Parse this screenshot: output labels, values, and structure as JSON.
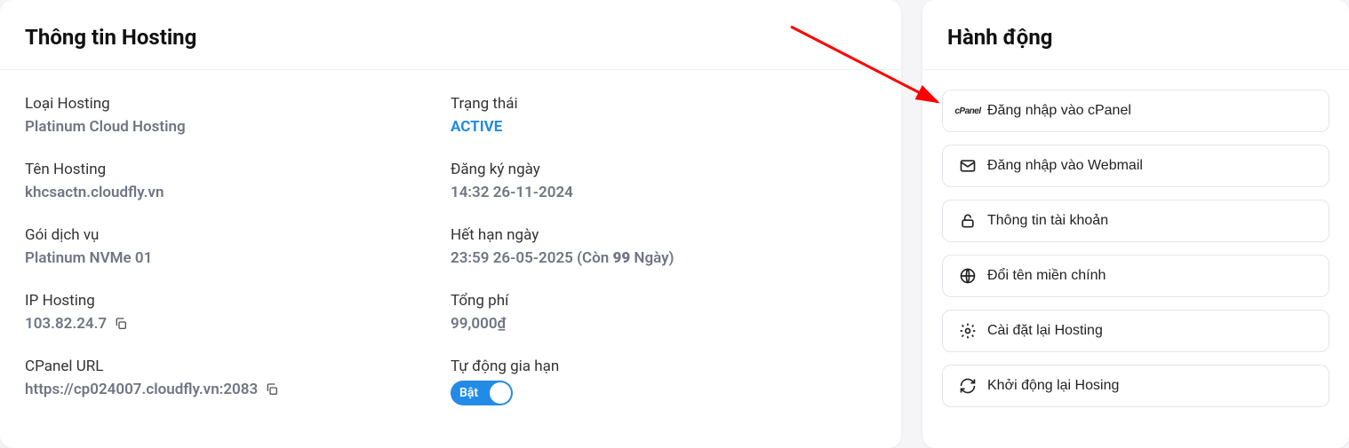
{
  "info": {
    "title": "Thông tin Hosting",
    "left": {
      "hosting_type_label": "Loại Hosting",
      "hosting_type_value": "Platinum Cloud Hosting",
      "hosting_name_label": "Tên Hosting",
      "hosting_name_value": "khcsactn.cloudfly.vn",
      "package_label": "Gói dịch vụ",
      "package_value": "Platinum NVMe 01",
      "ip_label": "IP Hosting",
      "ip_value": "103.82.24.7",
      "cpanel_url_label": "CPanel URL",
      "cpanel_url_value": "https://cp024007.cloudfly.vn:2083"
    },
    "right": {
      "status_label": "Trạng thái",
      "status_value": "ACTIVE",
      "reg_label": "Đăng ký ngày",
      "reg_value": "14:32 26-11-2024",
      "expire_label": "Hết hạn ngày",
      "expire_prefix": "23:59 26-05-2025 (Còn ",
      "expire_days": "99",
      "expire_suffix": " Ngày)",
      "total_label": "Tổng phí",
      "total_value": "99,000₫",
      "autorenew_label": "Tự động gia hạn",
      "autorenew_on": "Bật"
    }
  },
  "actions": {
    "title": "Hành động",
    "cpanel_login": "Đăng nhập vào cPanel",
    "webmail_login": "Đăng nhập vào Webmail",
    "account_info": "Thông tin tài khoản",
    "change_domain": "Đổi tên miền chính",
    "reinstall": "Cài đặt lại Hosting",
    "restart": "Khởi động lại Hosing"
  }
}
